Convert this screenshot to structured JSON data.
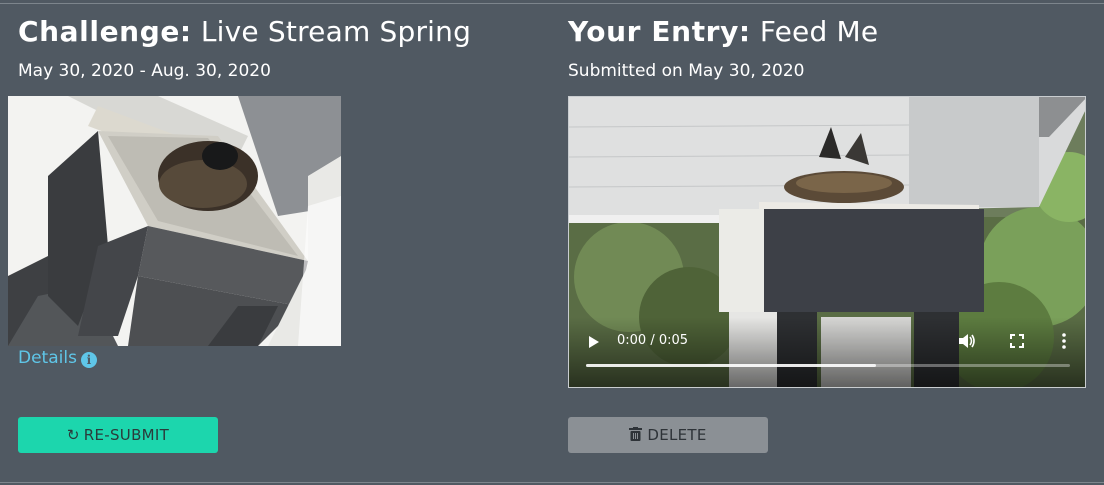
{
  "challenge": {
    "label": "Challenge:",
    "title": "Live Stream Spring",
    "dates": "May 30, 2020 - Aug. 30, 2020",
    "details_label": "Details",
    "details_icon": "info-circle-icon",
    "resubmit_label": "RE-SUBMIT",
    "resubmit_icon": "redo-icon"
  },
  "entry": {
    "label": "Your Entry:",
    "title": "Feed Me",
    "submitted": "Submitted on May 30, 2020",
    "delete_label": "DELETE",
    "delete_icon": "trash-icon"
  },
  "video": {
    "time": "0:00 / 0:05",
    "played_fraction": 0.6
  },
  "colors": {
    "background": "#505962",
    "accent_teal": "#1cd6ad",
    "link_blue": "#5fc6e8",
    "delete_gray": "#8b9095"
  }
}
